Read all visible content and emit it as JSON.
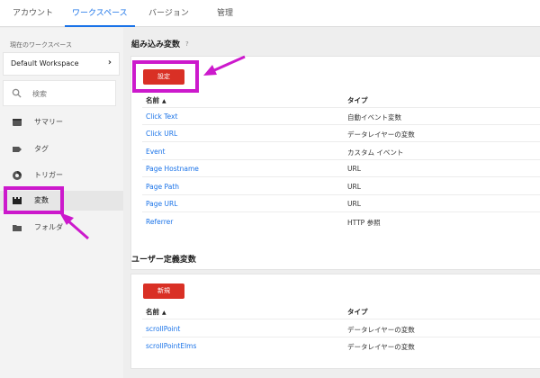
{
  "topbar": {
    "tabs": [
      {
        "label": "アカウント"
      },
      {
        "label": "ワークスペース"
      },
      {
        "label": "バージョン"
      },
      {
        "label": "管理"
      }
    ]
  },
  "sidebar": {
    "workspace_label": "現在のワークスペース",
    "workspace_name": "Default Workspace",
    "search_placeholder": "検索",
    "nav": [
      {
        "label": "サマリー",
        "icon": "summary-icon"
      },
      {
        "label": "タグ",
        "icon": "tag-icon"
      },
      {
        "label": "トリガー",
        "icon": "trigger-icon"
      },
      {
        "label": "変数",
        "icon": "variables-icon"
      },
      {
        "label": "フォルダ",
        "icon": "folder-icon"
      }
    ]
  },
  "builtin": {
    "title": "組み込み変数",
    "help": "?",
    "config_button": "設定",
    "col_name": "名前",
    "col_type": "タイプ",
    "rows": [
      {
        "name": "Click Text",
        "type": "自動イベント変数"
      },
      {
        "name": "Click URL",
        "type": "データレイヤーの変数"
      },
      {
        "name": "Event",
        "type": "カスタム イベント"
      },
      {
        "name": "Page Hostname",
        "type": "URL"
      },
      {
        "name": "Page Path",
        "type": "URL"
      },
      {
        "name": "Page URL",
        "type": "URL"
      },
      {
        "name": "Referrer",
        "type": "HTTP 参照"
      }
    ]
  },
  "user_defined": {
    "title": "ユーザー定義変数",
    "new_button": "新規",
    "col_name": "名前",
    "col_type": "タイプ",
    "rows": [
      {
        "name": "scrollPoint",
        "type": "データレイヤーの変数"
      },
      {
        "name": "scrollPointElms",
        "type": "データレイヤーの変数"
      }
    ]
  },
  "colors": {
    "accent": "#1a73e8",
    "button": "#d93025",
    "annotation": "#cc19cc"
  }
}
